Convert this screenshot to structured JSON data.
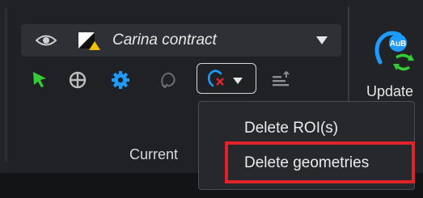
{
  "structure_selector": {
    "label": "Carina contract"
  },
  "toolbar": {
    "group_label": "Current"
  },
  "right_tool": {
    "badge": "AuB",
    "label": "Update"
  },
  "delete_menu": {
    "items": [
      {
        "label": "Delete ROI(s)"
      },
      {
        "label": "Delete geometries"
      }
    ]
  },
  "colors": {
    "highlight": "#e0232a",
    "accent_blue": "#1e9bff",
    "accent_green": "#33cc33",
    "delete_red": "#e0232a",
    "contrast_yellow": "#f2c200"
  },
  "icons": [
    "eye-icon",
    "contrast-icon",
    "pointer-icon",
    "crosshair-icon",
    "settings-icon",
    "lasso-icon",
    "delete-roi-icon",
    "sort-icon",
    "union-update-icon"
  ]
}
